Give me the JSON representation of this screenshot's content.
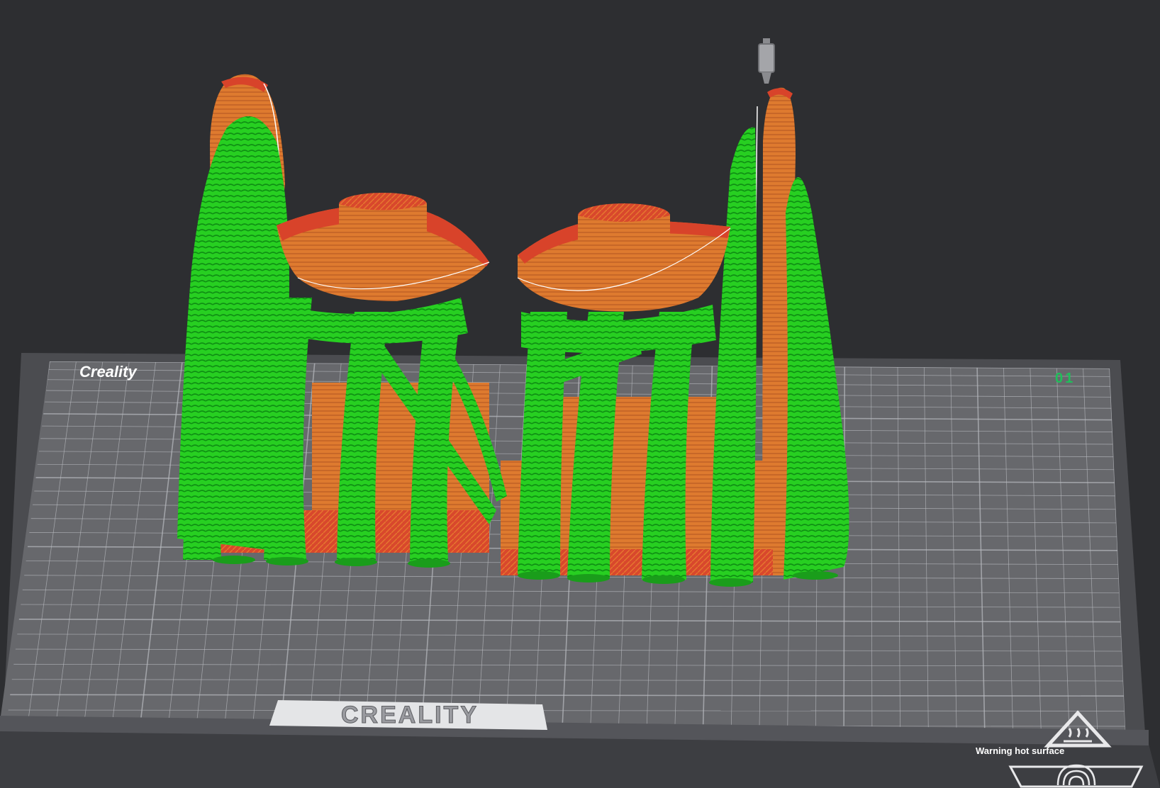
{
  "viewport": {
    "background": "#2d2e31",
    "bed": {
      "brand_top": "Creality",
      "plate_number": "01",
      "brand_bottom": "CREALITY",
      "warning_text": "Warning hot surface",
      "icons": [
        "hot-surface-warning-icon",
        "fingerprint-icon"
      ],
      "surface_color": "#6b6c70",
      "grid_color": "#b9bbc0",
      "plate_number_color": "#1fbf5a"
    },
    "model": {
      "preview_mode": "sliced",
      "model_color": "#e07a2e",
      "support_color": "#21d11f",
      "top_surface_color": "#d9432a",
      "objects": [
        "hat-left",
        "hat-right",
        "ring-left",
        "ring-right",
        "tree-supports"
      ]
    },
    "nozzle_icon": "nozzle-icon"
  }
}
